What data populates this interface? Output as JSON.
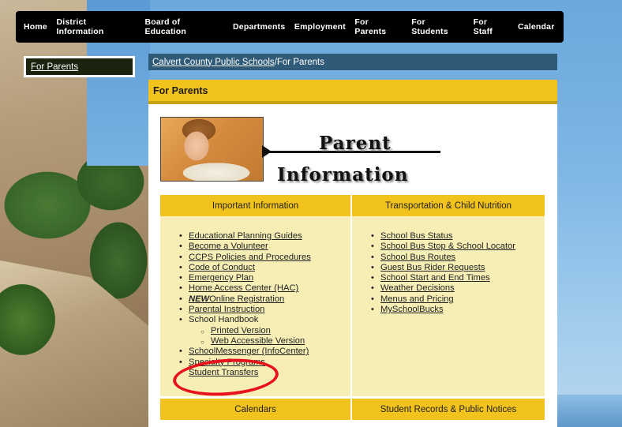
{
  "nav": {
    "items": [
      "Home",
      "District Information",
      "Board of Education",
      "Departments",
      "Employment",
      "For Parents",
      "For Students",
      "For Staff",
      "Calendar"
    ]
  },
  "sidebar": {
    "active_label": "For Parents"
  },
  "breadcrumb": {
    "root": "Calvert County Public Schools",
    "separator": " / ",
    "current": "For Parents"
  },
  "page": {
    "title": "For Parents"
  },
  "banner": {
    "line1": "Parent",
    "line2": "Information"
  },
  "table": {
    "left_heading": "Important Information",
    "right_heading": "Transportation & Child Nutrition",
    "left_links": [
      "Educational Planning Guides",
      "Become a Volunteer",
      "CCPS Policies and Procedures",
      "Code of Conduct",
      "Emergency Plan",
      "Home Access Center (HAC)"
    ],
    "online_registration": {
      "prefix": "NEW",
      "text": "Online Registration"
    },
    "parental_instruction": "Parental Instruction",
    "school_handbook": "School Handbook",
    "handbook_sub": [
      "Printed Version",
      "Web Accessible Version"
    ],
    "schoolmessenger": "SchoolMessenger (InfoCenter)",
    "partially_obscured": "Specialty Programs",
    "student_transfers": "Student Transfers",
    "right_links": [
      "School Bus Status",
      "School Bus Stop & School Locator",
      "School Bus Routes",
      "Guest Bus Rider Requests",
      "School Start and End Times",
      "Weather Decisions",
      "Menus and Pricing",
      "MySchoolBucks"
    ],
    "footer_left": "Calendars",
    "footer_right": "Student Records & Public Notices"
  },
  "colors": {
    "nav_bg": "#000000",
    "header_yellow": "#f2c31c",
    "table_bg": "#f7eeb6",
    "breadcrumb_bg": "#2f5a78",
    "highlight_red": "#e8121c"
  }
}
